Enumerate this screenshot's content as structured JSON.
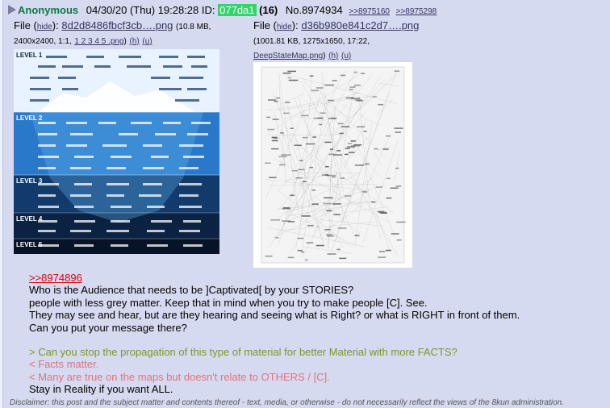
{
  "intro": {
    "name": "Anonymous",
    "datetime": "04/30/20 (Thu) 19:28:28",
    "id_label": "ID:",
    "id_value": "077da1",
    "post_count": "(16)",
    "post_no": "No.8974934",
    "backlinks": [
      ">>8975160",
      ">>8975298"
    ]
  },
  "files": [
    {
      "prefix": "File (",
      "hide": "hide",
      "filename": "8d2d8486fbcf3cb….png",
      "meta1": "(10.8 MB,",
      "meta2": "2400x2400, 1:1,",
      "links": "1 2 3 4 5 .png",
      "h": "(h)",
      "u": "(u)",
      "thumb_levels": [
        "LEVEL 1",
        "LEVEL 2",
        "LEVEL 3",
        "LEVEL 4",
        "LEVEL 5"
      ],
      "thumb_colors": [
        "#1a4f9a",
        "#2a78c9",
        "#123a6b",
        "#0c2243",
        "#081327"
      ]
    },
    {
      "prefix": "File (",
      "hide": "hide",
      "filename": "d36b980e841c2d7….png",
      "meta1": "(1001.81 KB, 1275x1650, 17:22,",
      "meta2": "DeepStateMap.png",
      "h": "(h)",
      "u": "(u)"
    }
  ],
  "body": {
    "quotelink": ">>8974896",
    "lines": [
      {
        "text": "Who is the Audience that needs to be ]Captivated[ by your STORIES?",
        "kind": "normal"
      },
      {
        "text": "people with less grey matter. Keep that in mind when you try to make people [C]. See.",
        "kind": "normal"
      },
      {
        "text": "They may see and hear, but are they hearing and seeing what is Right? or what is RIGHT in front of them.",
        "kind": "normal"
      },
      {
        "text": "Can you put your message there?",
        "kind": "normal"
      },
      {
        "text": "",
        "kind": "blank"
      },
      {
        "text": "> Can you stop the propagation of this type of material for better Material with more FACTS?",
        "kind": "green"
      },
      {
        "text": "< Facts matter.",
        "kind": "red"
      },
      {
        "text": "< Many are true on the maps but doesn't relate to OTHERS / [C].",
        "kind": "red"
      },
      {
        "text": "Stay in Reality if you want ALL.",
        "kind": "normal"
      }
    ]
  },
  "disclaimer": "Disclaimer: this post and the subject matter and contents thereof - text, media, or otherwise - do not necessarily reflect the views of the 8kun administration."
}
